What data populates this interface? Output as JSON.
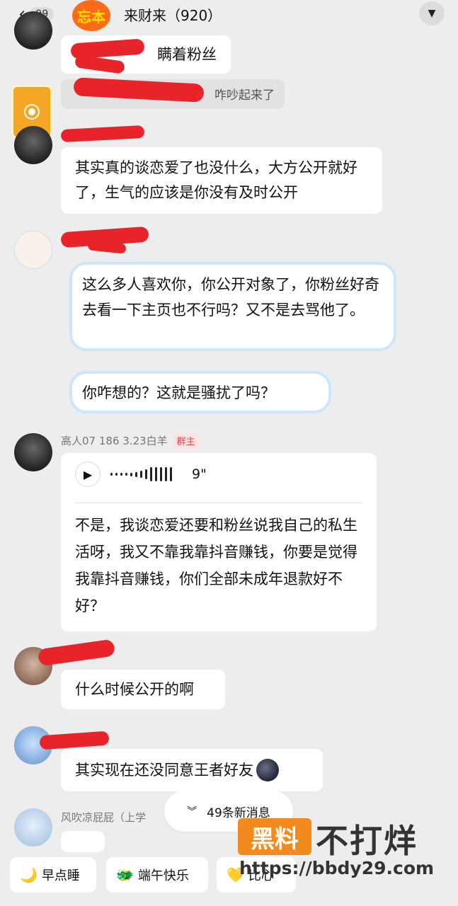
{
  "header": {
    "back_icon": "chevron-left-icon",
    "unread_count": "99",
    "group_logo_text": "忘本",
    "title": "来财来（920）",
    "dropdown_icon": "caret-down-icon"
  },
  "messages": {
    "m1_text": "瞒着粉丝",
    "m2_text": "咋吵起来了",
    "m3_text": "其实真的谈恋爱了也没什么，大方公开就好了，生气的应该是你没有及时公开",
    "m4_text": "这么多人喜欢你，你公开对象了，你粉丝好奇去看一下主页也不行吗？又不是去骂他了。",
    "m5_text": "你咋想的？这就是骚扰了吗？",
    "owner": {
      "name": "高人07  186  3.23白羊",
      "badge": "群主",
      "voice_duration": "9\"",
      "text": "不是，我谈恋爱还要和粉丝说我自己的私生活呀，我又不靠我靠抖音赚钱，你要是觉得我靠抖音赚钱，你们全部未成年退款好不好？"
    },
    "m7_text": "什么时候公开的啊",
    "m8_text": "其实现在还没同意王者好友",
    "m9_name": "风吹凉屁屁（上学"
  },
  "new_messages_label": "49条新消息",
  "quick_replies": [
    {
      "label": "早点睡",
      "icon": "moon-icon"
    },
    {
      "label": "端午快乐",
      "icon": "dragon-icon"
    },
    {
      "label": "比心",
      "icon": "heart-hand-icon"
    }
  ],
  "watermark": {
    "box": "黑料",
    "text": "不打烊",
    "url": "https://bbdy29.com"
  },
  "colors": {
    "background": "#ededed",
    "bubble": "#ffffff",
    "redaction": "#e8242a",
    "owner_badge": "#e04545"
  }
}
